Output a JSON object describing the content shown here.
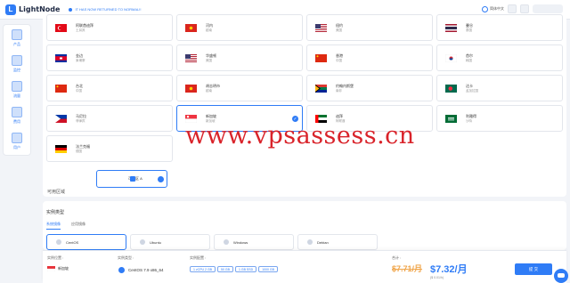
{
  "topbar": {
    "logo_text": "LightNode",
    "notice": "IT HAS NOW RETURNED TO NORMAL!!",
    "lang": "简体中文"
  },
  "sidebar": {
    "items": [
      {
        "label": "产品",
        "icon": "box-icon"
      },
      {
        "label": "监控",
        "icon": "monitor-icon"
      },
      {
        "label": "流量",
        "icon": "chart-icon"
      },
      {
        "label": "费用",
        "icon": "wallet-icon"
      },
      {
        "label": "用户",
        "icon": "user-icon"
      }
    ]
  },
  "regions": [
    {
      "name": "阿联酋迪拜",
      "sub": "土耳其",
      "flag": "turkey",
      "selected": false
    },
    {
      "name": "河内",
      "sub": "越南",
      "flag": "vietnam",
      "selected": false
    },
    {
      "name": "纽约",
      "sub": "美国",
      "flag": "usa",
      "selected": false
    },
    {
      "name": "曼谷",
      "sub": "泰国",
      "flag": "thailand",
      "selected": false
    },
    {
      "name": "金边",
      "sub": "柬埔寨",
      "flag": "cambodia",
      "selected": false
    },
    {
      "name": "华盛顿",
      "sub": "美国",
      "flag": "usa",
      "selected": false
    },
    {
      "name": "香港",
      "sub": "中国",
      "flag": "china",
      "selected": false
    },
    {
      "name": "首尔",
      "sub": "韩国",
      "flag": "korea",
      "selected": false
    },
    {
      "name": "台北",
      "sub": "中国",
      "flag": "china",
      "selected": false
    },
    {
      "name": "胡志明市",
      "sub": "越南",
      "flag": "vietnam",
      "selected": false
    },
    {
      "name": "约翰内斯堡",
      "sub": "南非",
      "flag": "southafrica",
      "selected": false
    },
    {
      "name": "达卡",
      "sub": "孟加拉国",
      "flag": "bangladesh",
      "selected": false
    },
    {
      "name": "马尼拉",
      "sub": "菲律宾",
      "flag": "philippines",
      "selected": false
    },
    {
      "name": "新加坡",
      "sub": "新加坡",
      "flag": "singapore",
      "selected": true
    },
    {
      "name": "迪拜",
      "sub": "阿联酋",
      "flag": "uae",
      "selected": false
    },
    {
      "name": "利雅得",
      "sub": "沙特",
      "flag": "saudi",
      "selected": false
    },
    {
      "name": "法兰克福",
      "sub": "德国",
      "flag": "germany",
      "selected": false
    }
  ],
  "zone": {
    "label": "可用区域",
    "option": "可用区 A"
  },
  "instance": {
    "title": "实例类型",
    "tabs": [
      "系统镜像",
      "应用镜像"
    ],
    "os": [
      "CentOS",
      "Ubuntu",
      "Windows",
      "Debian"
    ]
  },
  "bottom": {
    "location_label": "实例位置 :",
    "location": "新加坡",
    "type_label": "实例类型 :",
    "os_value": "CentOS 7.9 x86_64",
    "config_label": "实例配置 :",
    "chips": [
      "1 vCPU 2 GB",
      "50 GB",
      "1 GB SSD",
      "1000 GB"
    ],
    "total_label": "合计 :",
    "old_price": "$7.71/月",
    "new_price": "$7.32/月",
    "per_month": "($ 0.01/h)",
    "submit": "提 交"
  },
  "watermark": "www.vpsassess.cn",
  "colors": {
    "accent": "#2f7cf6",
    "watermark": "#d9232a",
    "old_price": "#f0a54a"
  }
}
